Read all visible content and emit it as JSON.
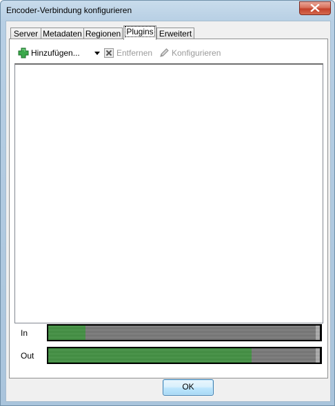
{
  "window": {
    "title": "Encoder-Verbindung konfigurieren"
  },
  "tabs": [
    {
      "label": "Server"
    },
    {
      "label": "Metadaten"
    },
    {
      "label": "Regionen"
    },
    {
      "label": "Plugins",
      "active": true
    },
    {
      "label": "Erweitert"
    }
  ],
  "toolbar": {
    "add_label": "Hinzufügen...",
    "add_icon": "green-plus-icon",
    "remove_label": "Entfernen",
    "remove_icon": "remove-x-icon",
    "configure_label": "Konfigurieren",
    "configure_icon": "pencil-icon"
  },
  "meters": {
    "in_label": "In",
    "in_level": 0.14,
    "out_label": "Out",
    "out_level": 0.76
  },
  "buttons": {
    "ok_label": "OK"
  },
  "colors": {
    "meter_active": "#4c9a4c",
    "meter_inactive": "#7a7a7a"
  }
}
